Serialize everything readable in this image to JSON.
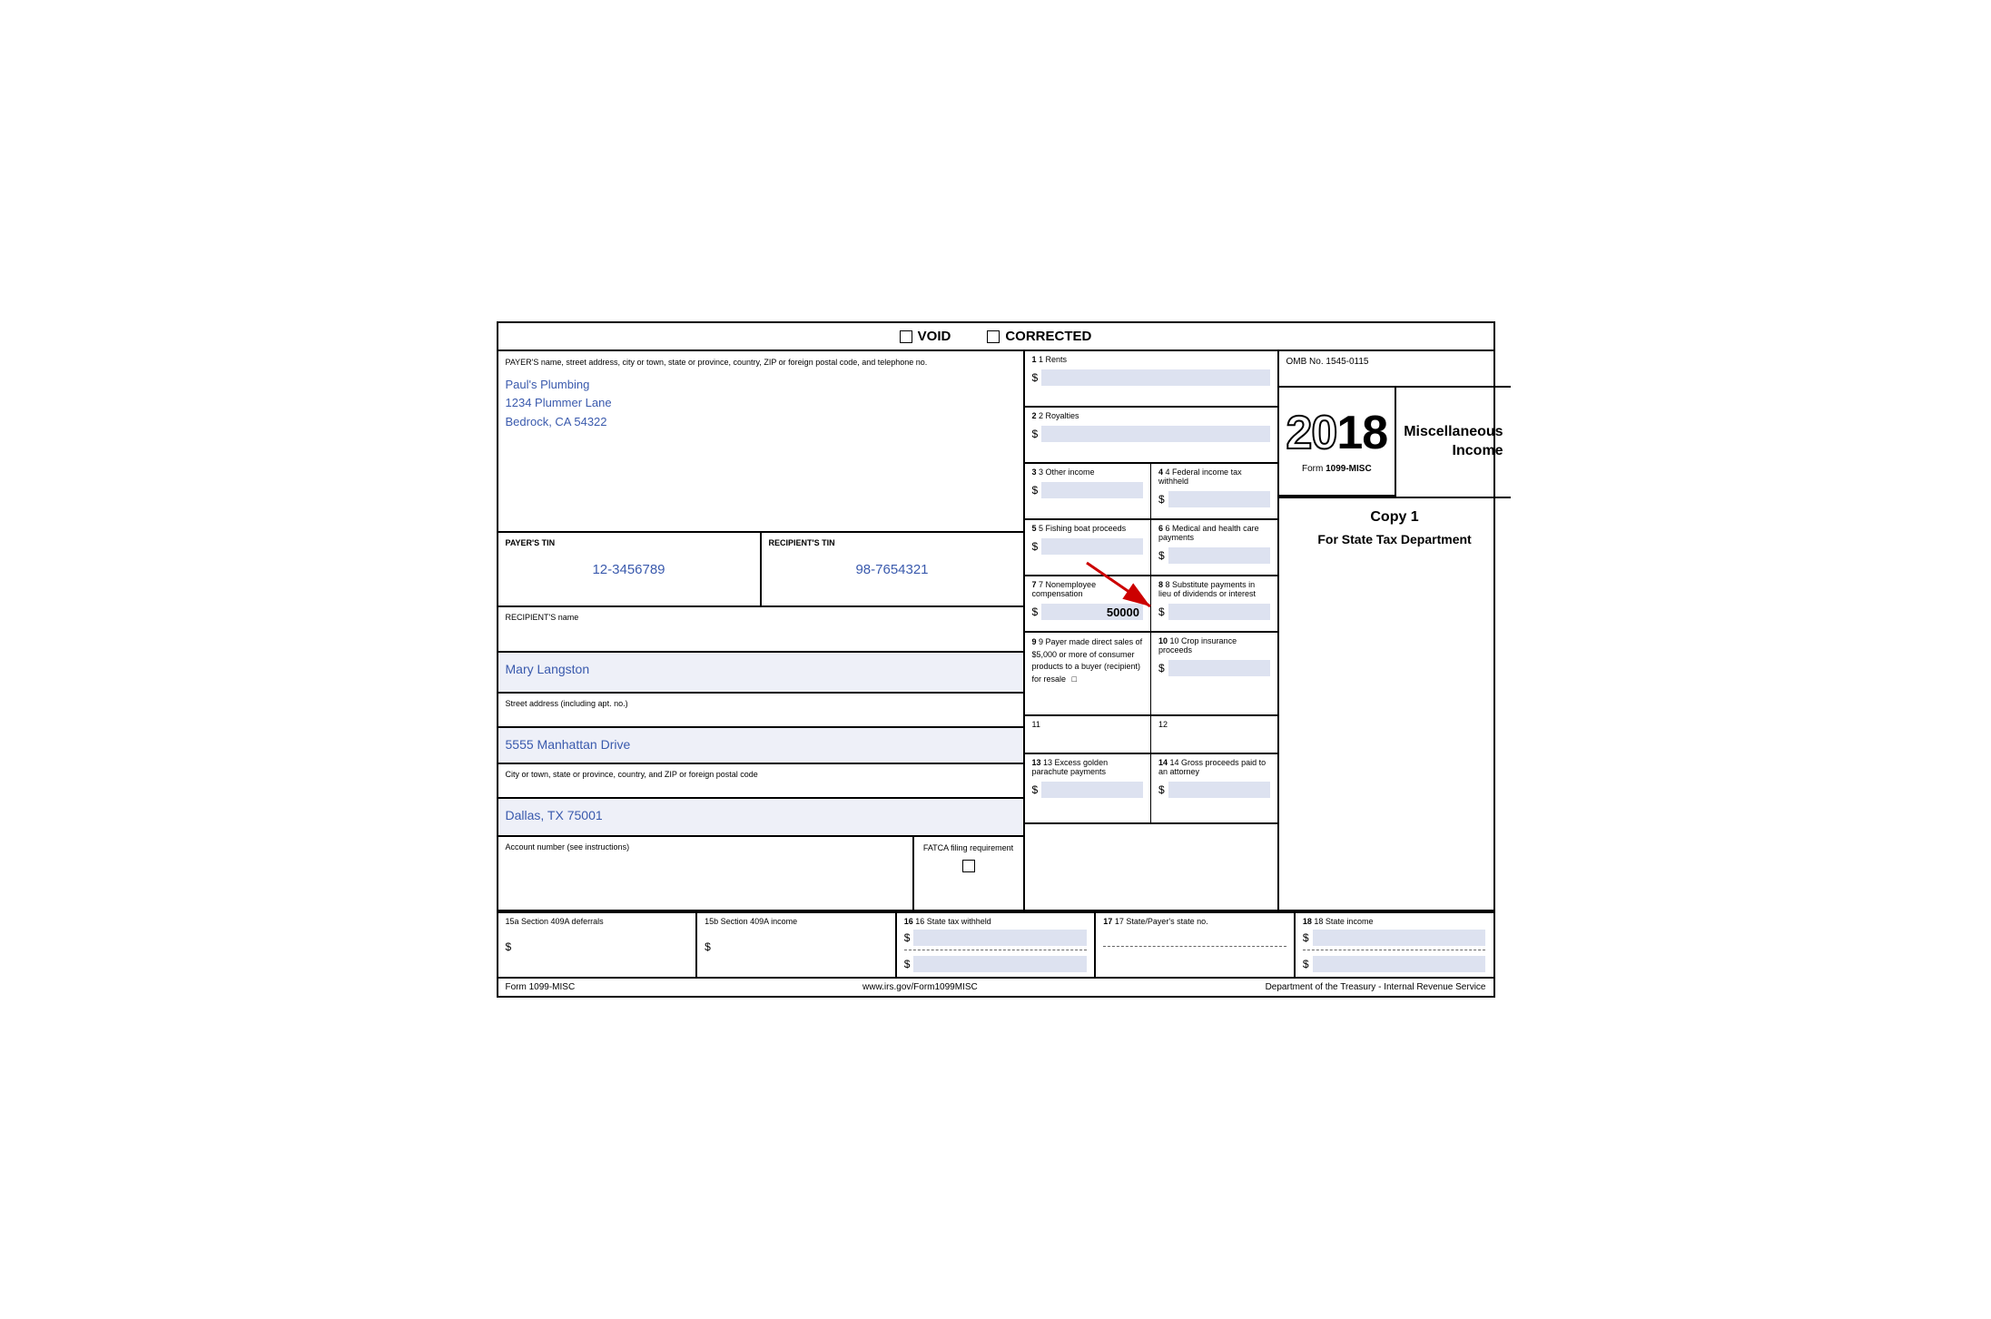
{
  "header": {
    "void_label": "VOID",
    "corrected_label": "CORRECTED"
  },
  "payer": {
    "field_label": "PAYER'S name, street address, city or town, state or province, country, ZIP or foreign postal code, and telephone no.",
    "name": "Paul's Plumbing",
    "address": "1234 Plummer Lane",
    "city_state_zip": "Bedrock, CA 54322"
  },
  "payer_tin": {
    "label": "PAYER'S TIN",
    "value": "12-3456789"
  },
  "recipient_tin": {
    "label": "RECIPIENT'S TIN",
    "value": "98-7654321"
  },
  "recipient": {
    "name_label": "RECIPIENT'S name",
    "name_value": "Mary Langston",
    "street_label": "Street address (including apt. no.)",
    "street_value": "5555 Manhattan Drive",
    "city_label": "City or town, state or province, country, and ZIP or foreign postal code",
    "city_value": "Dallas, TX 75001"
  },
  "account": {
    "label": "Account number (see instructions)"
  },
  "fatca": {
    "label": "FATCA filing requirement"
  },
  "boxes": {
    "box1_label": "1 Rents",
    "box2_label": "2 Royalties",
    "box3_label": "3 Other income",
    "box4_label": "4 Federal income tax withheld",
    "box5_label": "5 Fishing boat proceeds",
    "box6_label": "6 Medical and health care payments",
    "box7_label": "7 Nonemployee compensation",
    "box7_value": "50000",
    "box8_label": "8 Substitute payments in lieu of dividends or interest",
    "box9_label": "9 Payer made direct sales of $5,000 or more of consumer products to a buyer (recipient) for resale",
    "box10_label": "10 Crop insurance proceeds",
    "box11_label": "11",
    "box12_label": "12",
    "box13_label": "13 Excess golden parachute payments",
    "box14_label": "14 Gross proceeds paid to an attorney",
    "box15a_label": "15a Section 409A deferrals",
    "box15b_label": "15b Section 409A income",
    "box16_label": "16 State tax withheld",
    "box17_label": "17 State/Payer's state no.",
    "box18_label": "18 State income"
  },
  "omb": {
    "number": "OMB No. 1545-0115"
  },
  "year": {
    "display": "2018",
    "outline_part": "20",
    "bold_part": "18"
  },
  "form_name": {
    "form_label": "Form",
    "form_number": "1099-MISC"
  },
  "misc_income": {
    "title": "Miscellaneous Income"
  },
  "copy": {
    "copy_label": "Copy 1",
    "copy_desc": "For State Tax Department"
  },
  "footer": {
    "form_label": "Form 1099-MISC",
    "website": "www.irs.gov/Form1099MISC",
    "dept": "Department of the Treasury - Internal Revenue Service"
  }
}
